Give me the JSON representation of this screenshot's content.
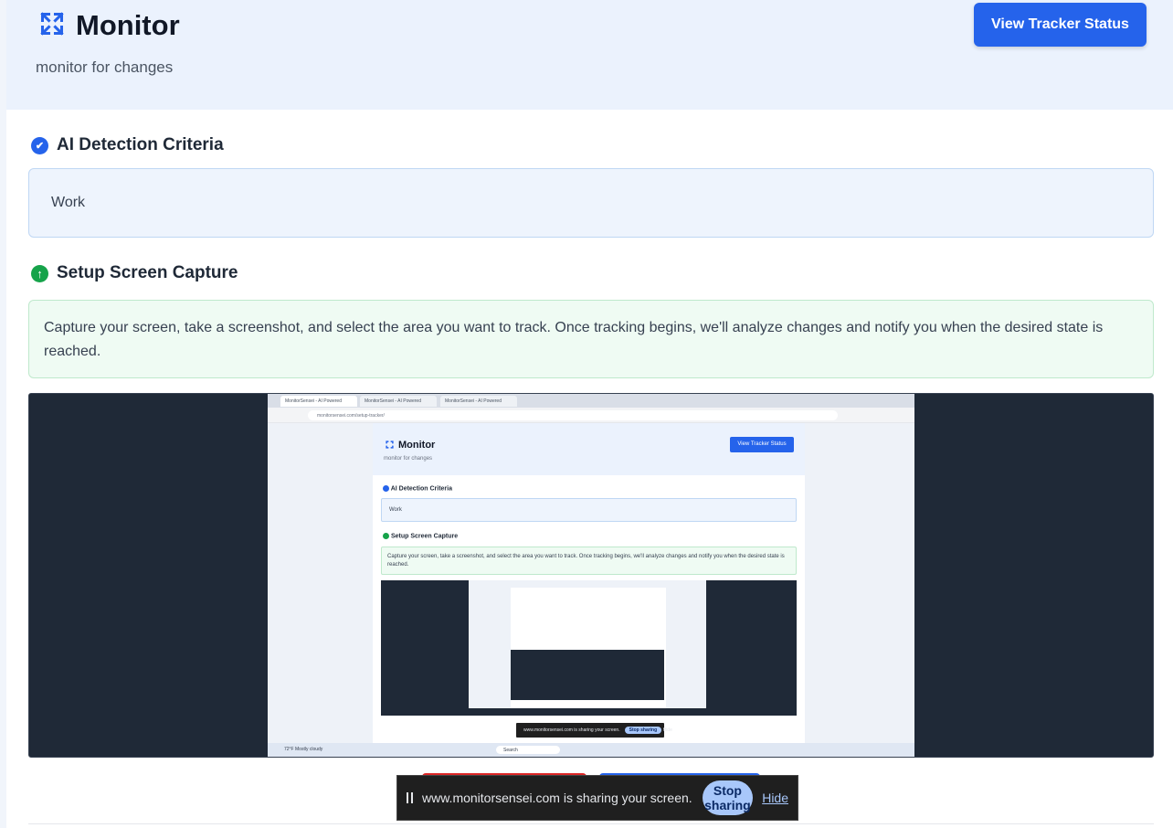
{
  "header": {
    "title": "Monitor",
    "subtitle": "monitor for changes",
    "tracker_button": "View Tracker Status",
    "icon": "expand-arrows-icon"
  },
  "criteria": {
    "heading": "AI Detection Criteria",
    "value": "Work",
    "icon": "check-circle-icon",
    "color": "#2563eb"
  },
  "capture": {
    "heading": "Setup Screen Capture",
    "description": "Capture your screen, take a screenshot, and select the area you want to track. Once tracking begins, we'll analyze changes and notify you when the desired state is reached.",
    "icon": "arrow-up-circle-icon",
    "color": "#16a34a"
  },
  "preview": {
    "mini_title": "Monitor",
    "mini_subtitle": "monitor for changes",
    "mini_button": "View Tracker Status",
    "mini_criteria_heading": "AI Detection Criteria",
    "mini_criteria_value": "Work",
    "mini_capture_heading": "Setup Screen Capture",
    "mini_description": "Capture your screen, take a screenshot, and select the area you want to track. Once tracking begins, we'll analyze changes and notify you when the desired state is reached.",
    "mini_share_text": "www.monitorsensei.com is sharing your screen.",
    "mini_stop": "Stop sharing",
    "mini_hide": "Hide",
    "mini_weather": "72°F Mostly cloudy",
    "mini_search": "Search"
  },
  "share_bar": {
    "text": "www.monitorsensei.com is sharing your screen.",
    "stop_label": "Stop sharing",
    "hide_label": "Hide"
  }
}
